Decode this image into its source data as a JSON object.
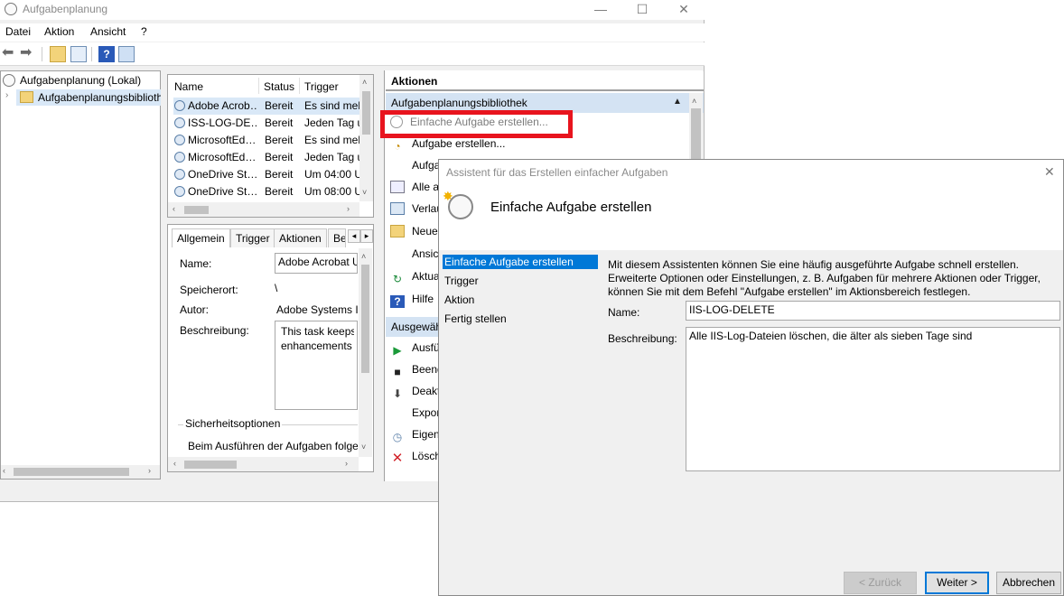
{
  "window": {
    "title": "Aufgabenplanung",
    "controls": {
      "minimize": "—",
      "maximize": "☐",
      "close": "✕"
    }
  },
  "menu": {
    "file": "Datei",
    "action": "Aktion",
    "view": "Ansicht",
    "help": "?"
  },
  "tree": {
    "root": "Aufgabenplanung (Lokal)",
    "child": "Aufgabenplanungsbibliothek"
  },
  "task_list": {
    "headers": {
      "name": "Name",
      "status": "Status",
      "trigger": "Trigger"
    },
    "rows": [
      {
        "name": "Adobe Acrob…",
        "status": "Bereit",
        "trigger": "Es sind meh"
      },
      {
        "name": "ISS-LOG-DE…",
        "status": "Bereit",
        "trigger": "Jeden Tag u"
      },
      {
        "name": "MicrosoftEd…",
        "status": "Bereit",
        "trigger": "Es sind meh"
      },
      {
        "name": "MicrosoftEd…",
        "status": "Bereit",
        "trigger": "Jeden Tag u"
      },
      {
        "name": "OneDrive St…",
        "status": "Bereit",
        "trigger": "Um 04:00 U"
      },
      {
        "name": "OneDrive St…",
        "status": "Bereit",
        "trigger": "Um 08:00 U"
      }
    ]
  },
  "details": {
    "tabs": {
      "general": "Allgemein",
      "trigger": "Trigger",
      "actions": "Aktionen",
      "more": "Be"
    },
    "labels": {
      "name": "Name:",
      "location": "Speicherort:",
      "author": "Autor:",
      "description": "Beschreibung:"
    },
    "values": {
      "name": "Adobe Acrobat U",
      "location": "\\",
      "author": "Adobe Systems I",
      "description_line1": "This task keeps y",
      "description_line2": "enhancements a"
    },
    "security_group": "Sicherheitsoptionen",
    "security_text": "Beim Ausführen der Aufgaben folge"
  },
  "actions_panel": {
    "header": "Aktionen",
    "section1": "Aufgabenplanungsbibliothek",
    "items": [
      "Einfache Aufgabe erstellen...",
      "Aufgabe erstellen...",
      "Aufga",
      "Alle a",
      "Verlau",
      "Neue",
      "Ansic",
      "Aktua",
      "Hilfe"
    ],
    "section2": "Ausgewäh",
    "items2": [
      "Ausfü",
      "Beend",
      "Deakt",
      "Expor",
      "Eigen",
      "Lösch"
    ]
  },
  "wizard": {
    "title": "Assistent für das Erstellen einfacher Aufgaben",
    "close": "✕",
    "heading": "Einfache Aufgabe erstellen",
    "steps": [
      "Einfache Aufgabe erstellen",
      "Trigger",
      "Aktion",
      "Fertig stellen"
    ],
    "intro_line1": "Mit diesem Assistenten können Sie eine häufig ausgeführte Aufgabe schnell erstellen.",
    "intro_line2": "Erweiterte Optionen oder Einstellungen, z. B. Aufgaben für mehrere Aktionen oder Trigger,",
    "intro_line3": "können Sie mit dem Befehl \"Aufgabe erstellen\" im Aktionsbereich festlegen.",
    "name_label": "Name:",
    "name_value": "IIS-LOG-DELETE",
    "description_label": "Beschreibung:",
    "description_value": "Alle IIS-Log-Dateien löschen, die älter als sieben Tage sind",
    "buttons": {
      "back": "< Zurück",
      "next": "Weiter >",
      "cancel": "Abbrechen"
    }
  },
  "colors": {
    "accent": "#0078d7",
    "highlight": "#e8141e",
    "section_bg": "#d4e3f3"
  },
  "icons": [
    "clock-icon",
    "back-icon",
    "forward-icon",
    "folder-up-icon",
    "help-icon",
    "play-icon",
    "stop-icon",
    "delete-icon"
  ]
}
